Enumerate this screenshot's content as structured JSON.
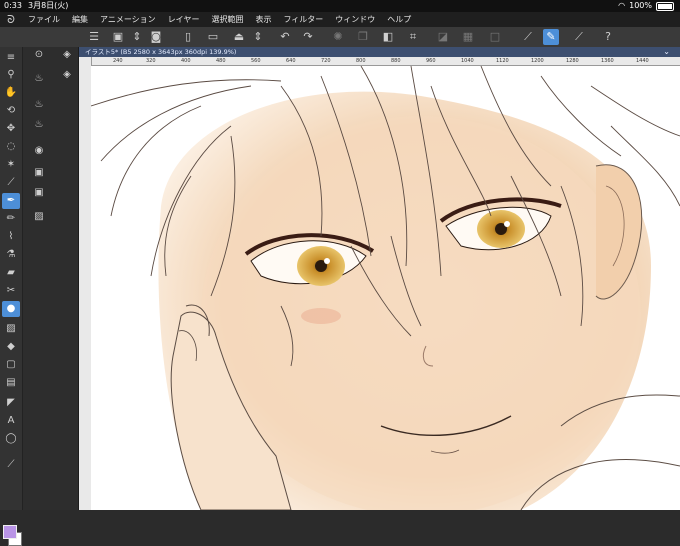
{
  "status_bar": {
    "time": "0:33",
    "date": "3月8日(火)",
    "battery": "100%"
  },
  "menu": [
    "ファイル",
    "編集",
    "アニメーション",
    "レイヤー",
    "選択範囲",
    "表示",
    "フィルター",
    "ウィンドウ",
    "ヘルプ"
  ],
  "icons": {
    "command_bar": [
      "menu-icon",
      "new-icon",
      "stepper-icon",
      "camera-icon",
      "new-doc-icon",
      "open-icon",
      "save-icon",
      "stepper-icon",
      "undo-icon",
      "redo-icon",
      "busy-icon",
      "copy-icon",
      "paste-icon",
      "transform-icon",
      "fill-icon",
      "tone-icon",
      "clear-icon",
      "rule-icon",
      "pen-pressure-icon",
      "stroke-icon",
      "help-icon"
    ],
    "tools": [
      "zoom-icon",
      "hand-icon",
      "rotate-icon",
      "move-icon",
      "lasso-icon",
      "magic-wand-icon",
      "eyedropper-icon",
      "pen-icon",
      "pencil-icon",
      "brush-icon",
      "airbrush-icon",
      "eraser-icon",
      "decoration-icon",
      "blend-icon",
      "gradient-icon",
      "fill-icon",
      "figure-icon",
      "frame-icon",
      "ruler-icon",
      "text-icon",
      "balloon-icon",
      "line-icon"
    ]
  },
  "document": {
    "tab_label": "イラスト5* (B5 2580 x 3643px 360dpi 139.9%)"
  },
  "ruler": {
    "ticks": [
      "240",
      "320",
      "400",
      "480",
      "560",
      "640",
      "720",
      "800",
      "880",
      "960",
      "1040",
      "1120",
      "1200",
      "1280",
      "1360",
      "1440"
    ]
  },
  "colors": {
    "main_color": "#b994e6",
    "sub_color": "#ffffff",
    "accent": "#4d8fd8"
  }
}
